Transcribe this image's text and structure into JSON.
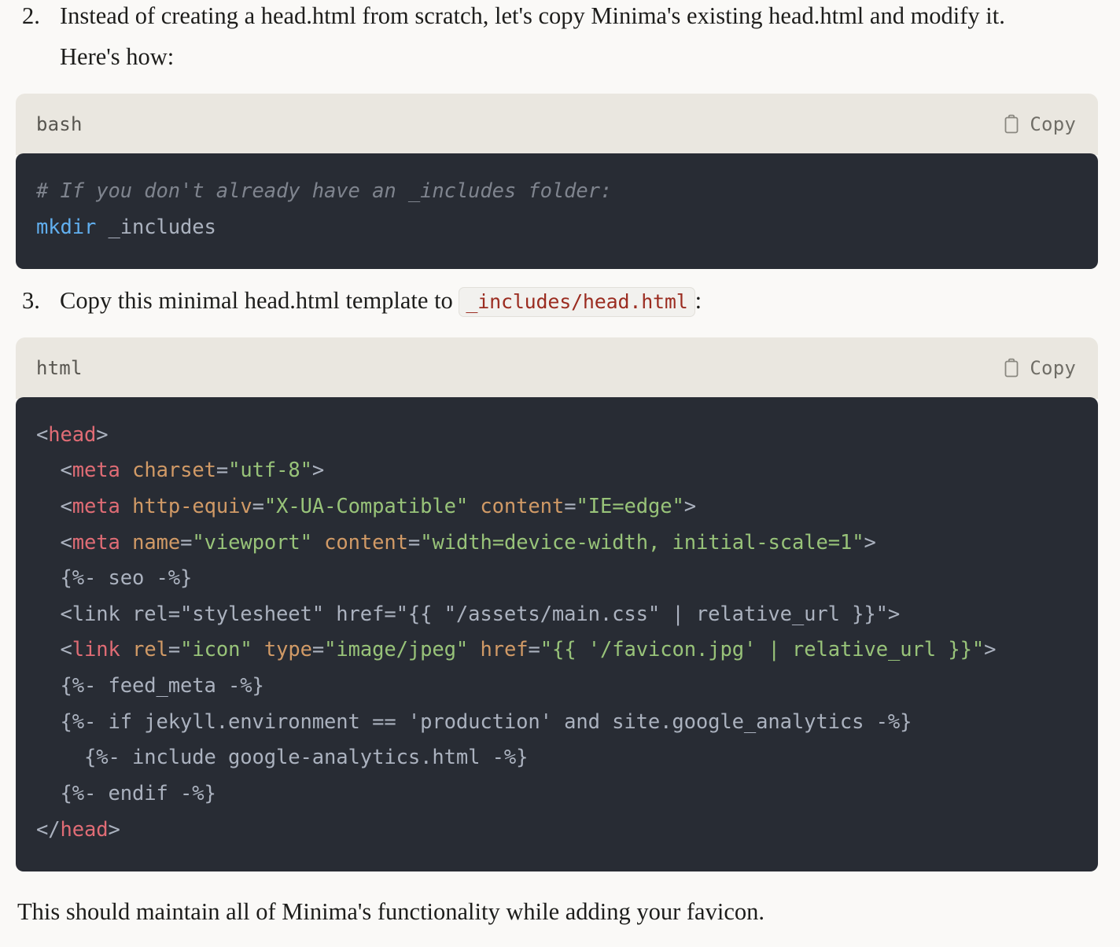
{
  "list": [
    {
      "marker": "2.",
      "text": "Instead of creating a head.html from scratch, let's copy Minima's existing head.html and modify it. Here's how:"
    },
    {
      "marker": "3.",
      "text_before": "Copy this minimal head.html template to ",
      "inline_code": "_includes/head.html",
      "text_after": ":"
    }
  ],
  "code_blocks": [
    {
      "language": "bash",
      "copy_label": "Copy",
      "copy_icon": "clipboard-icon",
      "lines": [
        "# If you don't already have an _includes folder:",
        "mkdir _includes"
      ]
    },
    {
      "language": "html",
      "copy_label": "Copy",
      "copy_icon": "clipboard-icon",
      "lines": [
        "<head>",
        "  <meta charset=\"utf-8\">",
        "  <meta http-equiv=\"X-UA-Compatible\" content=\"IE=edge\">",
        "  <meta name=\"viewport\" content=\"width=device-width, initial-scale=1\">",
        "  {%- seo -%}",
        "  <link rel=\"stylesheet\" href=\"{{ \"/assets/main.css\" | relative_url }}\">",
        "  <link rel=\"icon\" type=\"image/jpeg\" href=\"{{ '/favicon.jpg' | relative_url }}\">",
        "  {%- feed_meta -%}",
        "  {%- if jekyll.environment == 'production' and site.google_analytics -%}",
        "    {%- include google-analytics.html -%}",
        "  {%- endif -%}",
        "</head>"
      ]
    }
  ],
  "closing_paragraph": "This should maintain all of Minima's functionality while adding your favicon.",
  "colors": {
    "page_background": "#faf9f7",
    "code_background": "#282c34",
    "code_header_background": "#eae7e0",
    "tag": "#e06c75",
    "attribute": "#d19a66",
    "string": "#98c379",
    "keyword": "#61afef",
    "comment": "#7f848e",
    "plain": "#abb2bf",
    "inline_code_text": "#9b2c20"
  }
}
